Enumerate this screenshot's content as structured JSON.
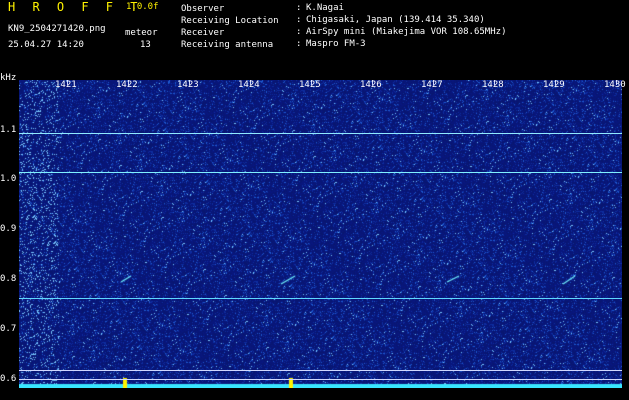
{
  "header": {
    "brand": "H R O F F T",
    "version": "1.0.0f",
    "filename": "KN9_2504271420.png",
    "meteor_label": "meteor",
    "datetime": "25.04.27 14:20",
    "meteor_count": "13"
  },
  "meta": [
    {
      "label": "Observer",
      "value": "K.Nagai"
    },
    {
      "label": "Receiving Location",
      "value": "Chigasaki, Japan (139.414 35.340)"
    },
    {
      "label": "Receiver",
      "value": "AirSpy mini (Miakejima VOR 108.65MHz)"
    },
    {
      "label": "Receiving antenna",
      "value": "Maspro FM-3"
    }
  ],
  "axis": {
    "y_unit": "kHz",
    "y_ticks": [
      "1.1",
      "1.0",
      "0.9",
      "0.8",
      "0.7",
      "0.6"
    ],
    "x_ticks": [
      "1421",
      "1422",
      "1423",
      "1424",
      "1425",
      "1426",
      "1427",
      "1428",
      "1429",
      "1430"
    ]
  },
  "colors": {
    "background": "#000000",
    "plot_bg": "#0a1a78",
    "brand": "#fff200",
    "signal": "#39e6ff"
  }
}
